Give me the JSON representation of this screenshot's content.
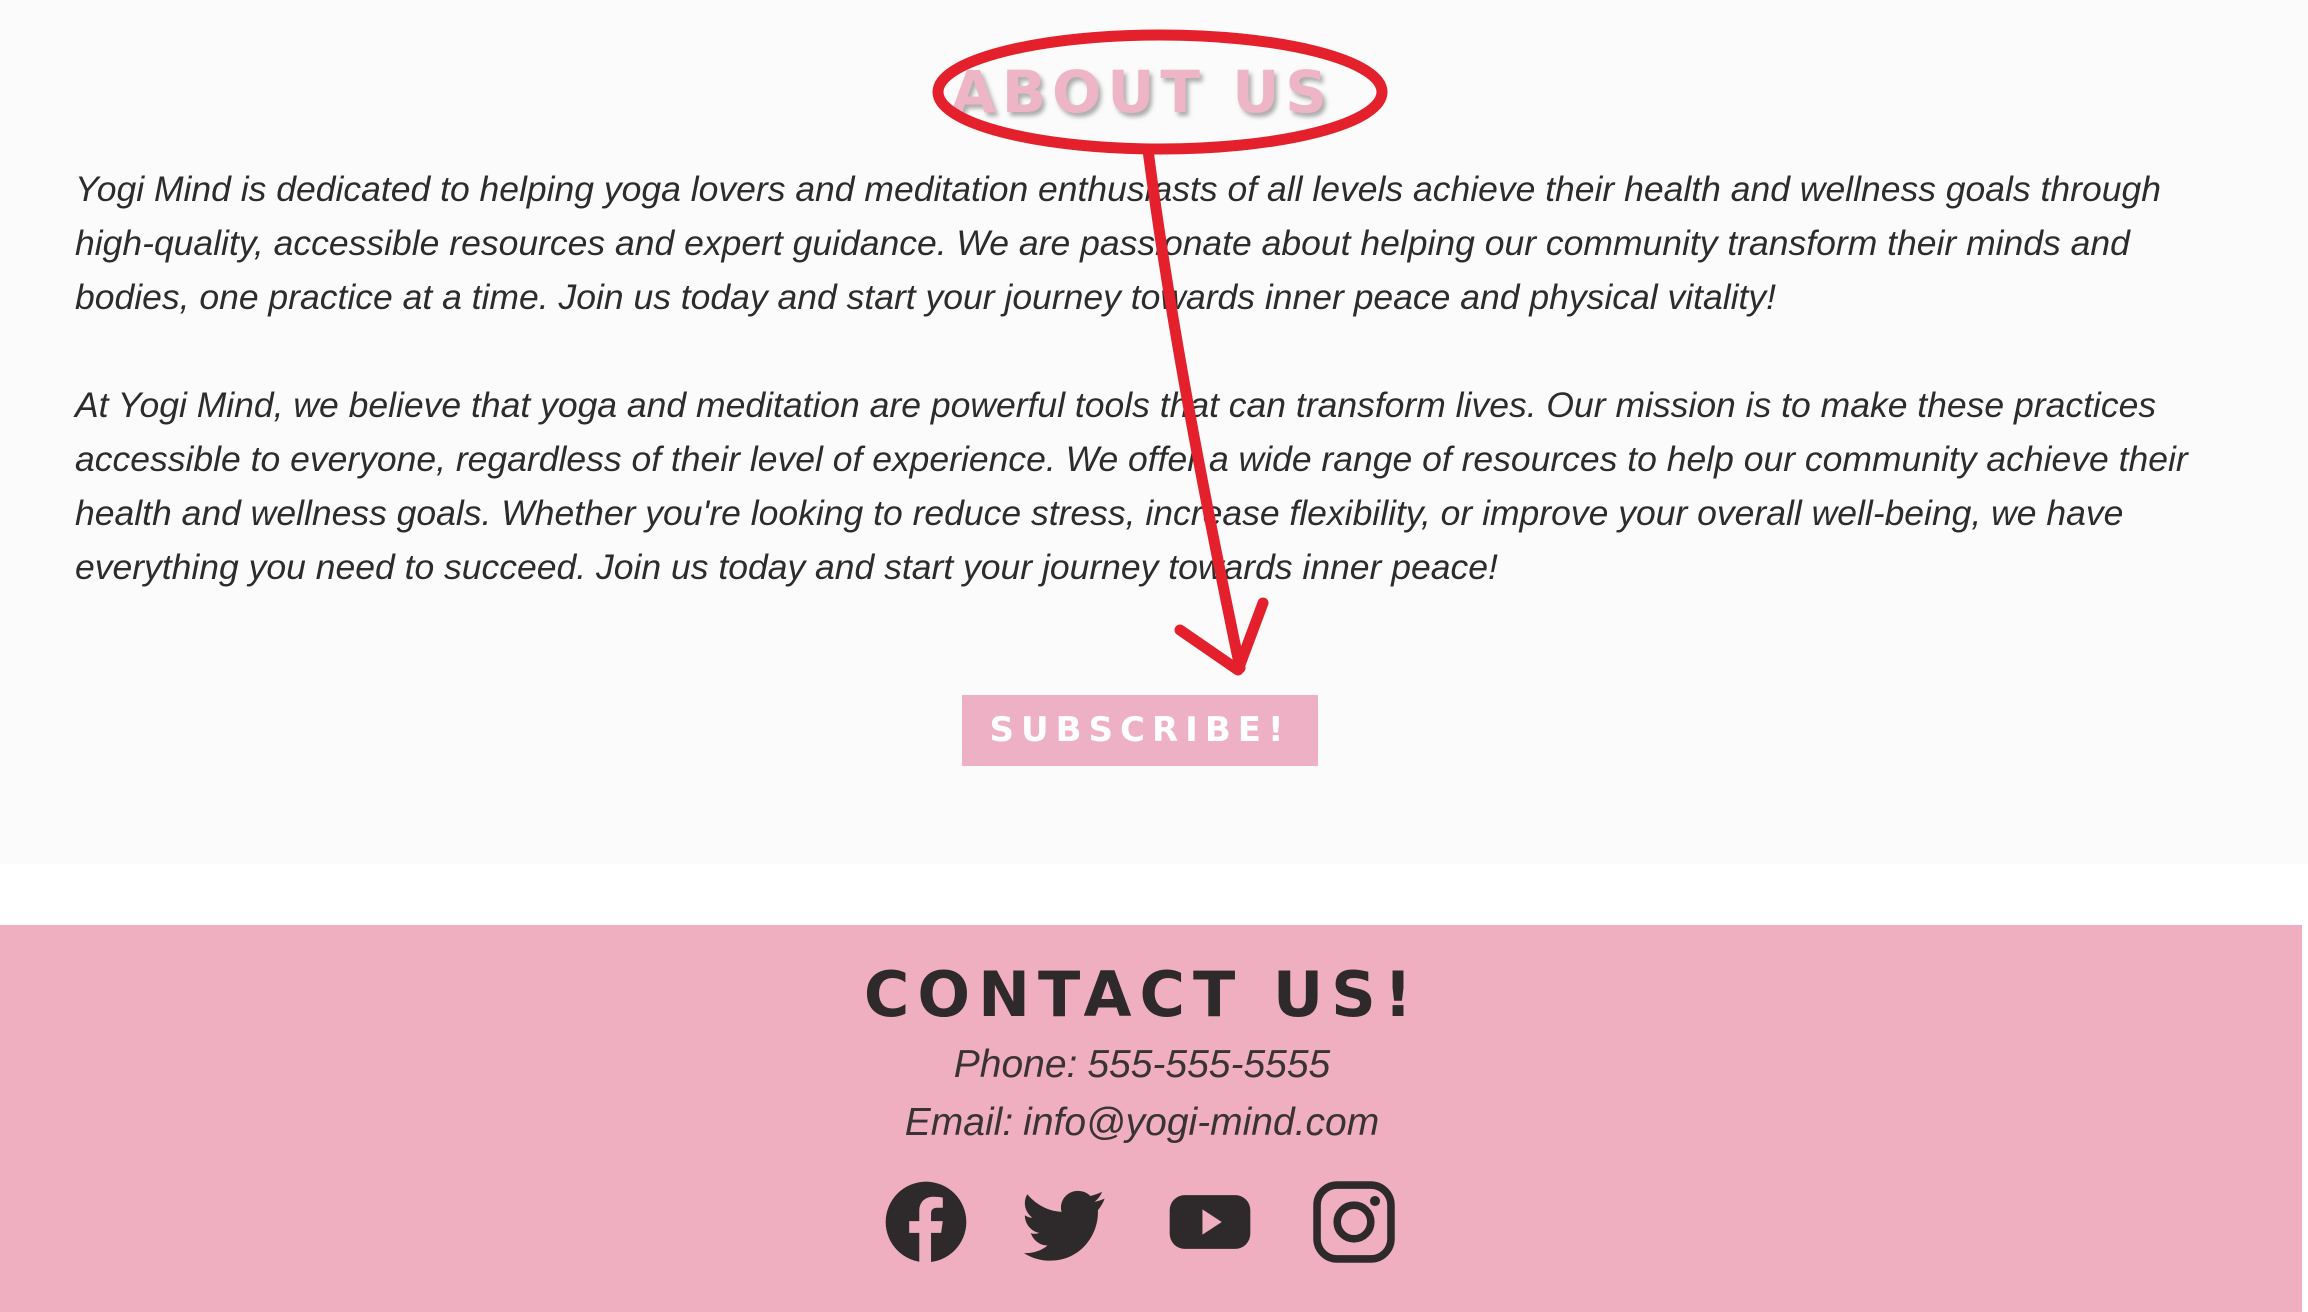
{
  "about": {
    "title": "ABOUT US",
    "paragraph_1": "Yogi Mind is dedicated to helping yoga lovers and meditation enthusiasts of all levels achieve their health and wellness goals through high-quality, accessible resources and expert guidance. We are passionate about helping our community transform their minds and bodies, one practice at a time. Join us today and start your journey towards inner peace and physical vitality!",
    "paragraph_2": "At Yogi Mind, we believe that yoga and meditation are powerful tools that can transform lives. Our mission is to make these practices accessible to everyone, regardless of their level of experience. We offer a wide range of resources to help our community achieve their health and wellness goals. Whether you're looking to reduce stress, increase flexibility, or improve your overall well-being, we have everything you need to succeed. Join us today and start your journey towards inner peace!",
    "subscribe_label": "SUBSCRIBE!"
  },
  "contact": {
    "title": "CONTACT US!",
    "phone_label": "Phone:",
    "phone_value": "555-555-5555",
    "email_label": "Email:",
    "email_value": "info@yogi-mind.com",
    "social_icons": [
      "facebook-icon",
      "twitter-icon",
      "youtube-icon",
      "instagram-icon"
    ]
  },
  "colors": {
    "accent_pink": "#eeb0c4",
    "footer_pink": "#f0aec1",
    "dark_text": "#2e2a2c",
    "annotation_red": "#e3202b"
  }
}
